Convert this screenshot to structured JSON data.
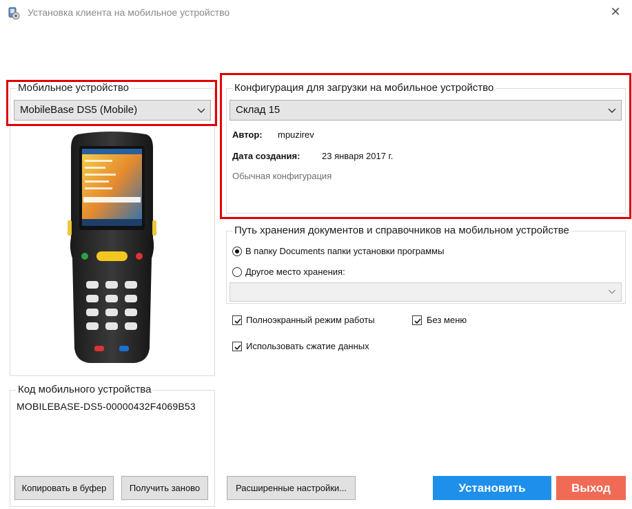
{
  "window": {
    "title": "Установка клиента на мобильное устройство",
    "close_icon": "close-icon"
  },
  "device_group": {
    "title": "Мобильное устройство",
    "selected": "MobileBase DS5 (Mobile)"
  },
  "config_group": {
    "title": "Конфигурация для загрузки на мобильное устройство",
    "selected": "Склад 15",
    "author_label": "Автор:",
    "author_value": "mpuzirev",
    "created_label": "Дата создания:",
    "created_value": "23 января 2017 г.",
    "description": "Обычная конфигурация"
  },
  "storage_group": {
    "title": "Путь хранения документов и справочников на мобильном устройстве",
    "option_documents": "В папку Documents папки установки программы",
    "option_other": "Другое место хранения:",
    "selected_option": "documents",
    "other_path": ""
  },
  "options": {
    "fullscreen_label": "Полноэкранный режим работы",
    "fullscreen_checked": true,
    "no_menu_label": "Без меню",
    "no_menu_checked": true,
    "compression_label": "Использовать сжатие данных",
    "compression_checked": true
  },
  "device_code_group": {
    "title": "Код мобильного устройства",
    "code": "MOBILEBASE-DS5-00000432F4069B53",
    "copy_label": "Копировать в буфер",
    "refresh_label": "Получить заново"
  },
  "footer": {
    "advanced_label": "Расширенные настройки...",
    "install_label": "Установить",
    "exit_label": "Выход"
  },
  "colors": {
    "highlight": "#e00000",
    "install_button": "#1e90ec",
    "exit_button": "#f16a55"
  }
}
